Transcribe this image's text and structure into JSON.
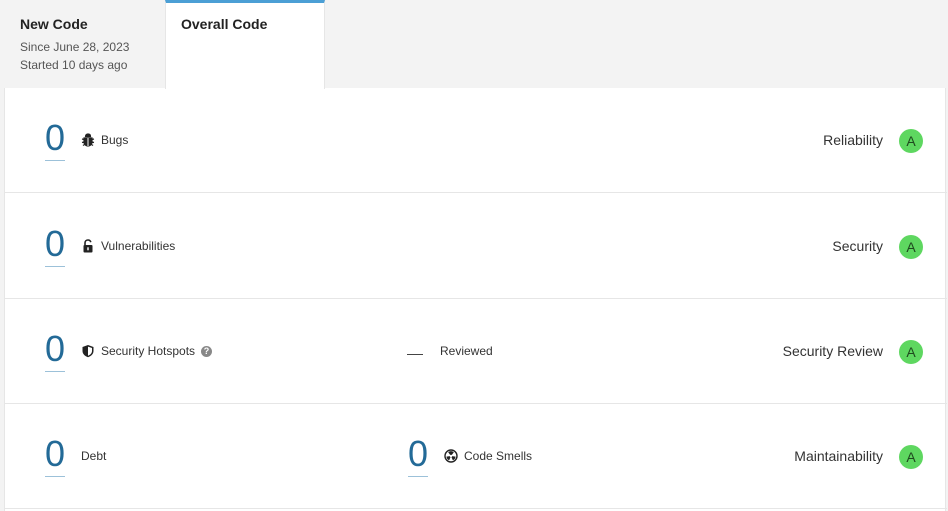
{
  "tabs": {
    "new_code": {
      "title": "New Code",
      "since": "Since June 28, 2023",
      "started": "Started 10 days ago"
    },
    "overall_code": {
      "title": "Overall Code"
    }
  },
  "rows": {
    "bugs": {
      "value": "0",
      "label": "Bugs",
      "icon": "bug-icon",
      "rating_label": "Reliability",
      "rating": "A"
    },
    "vulnerabilities": {
      "value": "0",
      "label": "Vulnerabilities",
      "icon": "unlock-icon",
      "rating_label": "Security",
      "rating": "A"
    },
    "hotspots": {
      "value": "0",
      "label": "Security Hotspots",
      "icon": "shield-icon",
      "help_icon": "help-icon",
      "reviewed_value": "—",
      "reviewed_label": "Reviewed",
      "rating_label": "Security Review",
      "rating": "A"
    },
    "maintainability": {
      "value": "0",
      "label": "Debt",
      "smells_value": "0",
      "smells_label": "Code Smells",
      "smells_icon": "radiation-icon",
      "rating_label": "Maintainability",
      "rating": "A"
    }
  },
  "colors": {
    "accent": "#4b9fd5",
    "value": "#236a97",
    "rating_a": "#5ed760"
  }
}
